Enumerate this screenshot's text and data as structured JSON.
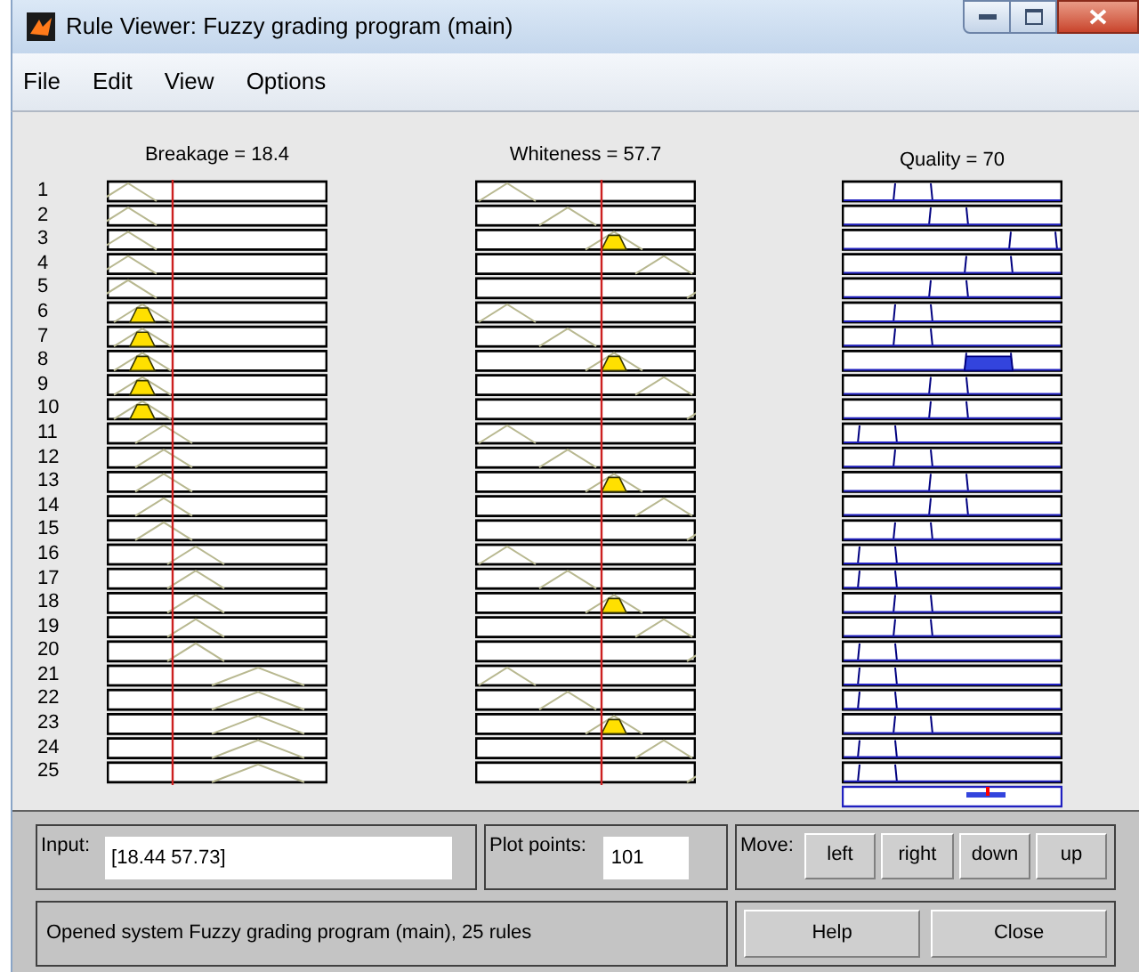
{
  "window": {
    "title": "Rule Viewer: Fuzzy grading program (main)"
  },
  "menu": [
    "File",
    "Edit",
    "View",
    "Options"
  ],
  "columns": [
    {
      "kind": "input",
      "label": "Breakage = 18.4"
    },
    {
      "kind": "input",
      "label": "Whiteness = 57.7"
    },
    {
      "kind": "output",
      "label": "Quality = 70"
    }
  ],
  "rules": [
    "1",
    "2",
    "3",
    "4",
    "5",
    "6",
    "7",
    "8",
    "9",
    "10",
    "11",
    "12",
    "13",
    "14",
    "15",
    "16",
    "17",
    "18",
    "19",
    "20",
    "21",
    "22",
    "23",
    "24",
    "25"
  ],
  "input": {
    "label": "Input:",
    "value": "[18.44 57.73]"
  },
  "plot_points": {
    "label": "Plot points:",
    "value": "101"
  },
  "move": {
    "label": "Move:",
    "buttons": [
      "left",
      "right",
      "down",
      "up"
    ]
  },
  "status": "Opened system Fuzzy grading program (main), 25 rules",
  "buttons": [
    "Help",
    "Close"
  ]
}
